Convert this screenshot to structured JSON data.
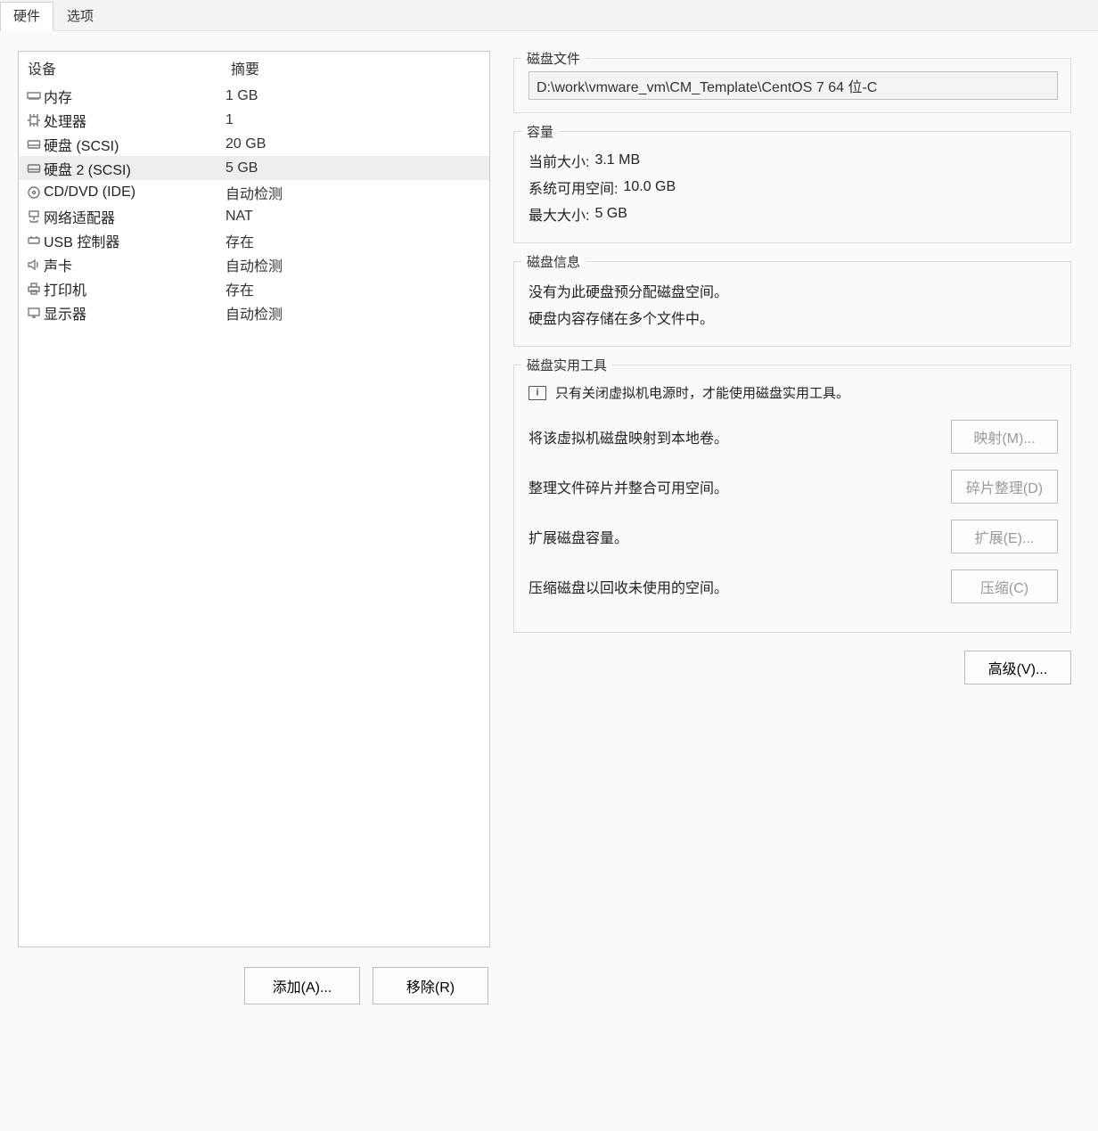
{
  "tabs": {
    "hardware": "硬件",
    "options": "选项"
  },
  "headers": {
    "device": "设备",
    "summary": "摘要"
  },
  "devices": [
    {
      "icon": "memory-icon",
      "name": "内存",
      "summary": "1 GB"
    },
    {
      "icon": "cpu-icon",
      "name": "处理器",
      "summary": "1"
    },
    {
      "icon": "disk-icon",
      "name": "硬盘 (SCSI)",
      "summary": "20 GB"
    },
    {
      "icon": "disk-icon",
      "name": "硬盘 2 (SCSI)",
      "summary": "5 GB"
    },
    {
      "icon": "cd-icon",
      "name": "CD/DVD (IDE)",
      "summary": "自动检测"
    },
    {
      "icon": "network-icon",
      "name": "网络适配器",
      "summary": "NAT"
    },
    {
      "icon": "usb-icon",
      "name": "USB 控制器",
      "summary": "存在"
    },
    {
      "icon": "sound-icon",
      "name": "声卡",
      "summary": "自动检测"
    },
    {
      "icon": "printer-icon",
      "name": "打印机",
      "summary": "存在"
    },
    {
      "icon": "display-icon",
      "name": "显示器",
      "summary": "自动检测"
    }
  ],
  "selected_index": 3,
  "buttons": {
    "add": "添加(A)...",
    "remove": "移除(R)",
    "map": "映射(M)...",
    "defrag": "碎片整理(D)",
    "expand": "扩展(E)...",
    "compact": "压缩(C)",
    "advanced": "高级(V)..."
  },
  "disk_file": {
    "legend": "磁盘文件",
    "path": "D:\\work\\vmware_vm\\CM_Template\\CentOS 7 64 位-C"
  },
  "capacity": {
    "legend": "容量",
    "current_label": "当前大小:",
    "current_value": "3.1 MB",
    "free_label": "系统可用空间:",
    "free_value": "10.0 GB",
    "max_label": "最大大小:",
    "max_value": "5 GB"
  },
  "disk_info": {
    "legend": "磁盘信息",
    "line1": "没有为此硬盘预分配磁盘空间。",
    "line2": "硬盘内容存储在多个文件中。"
  },
  "disk_util": {
    "legend": "磁盘实用工具",
    "note": "只有关闭虚拟机电源时，才能使用磁盘实用工具。",
    "map_desc": "将该虚拟机磁盘映射到本地卷。",
    "defrag_desc": "整理文件碎片并整合可用空间。",
    "expand_desc": "扩展磁盘容量。",
    "compact_desc": "压缩磁盘以回收未使用的空间。"
  }
}
